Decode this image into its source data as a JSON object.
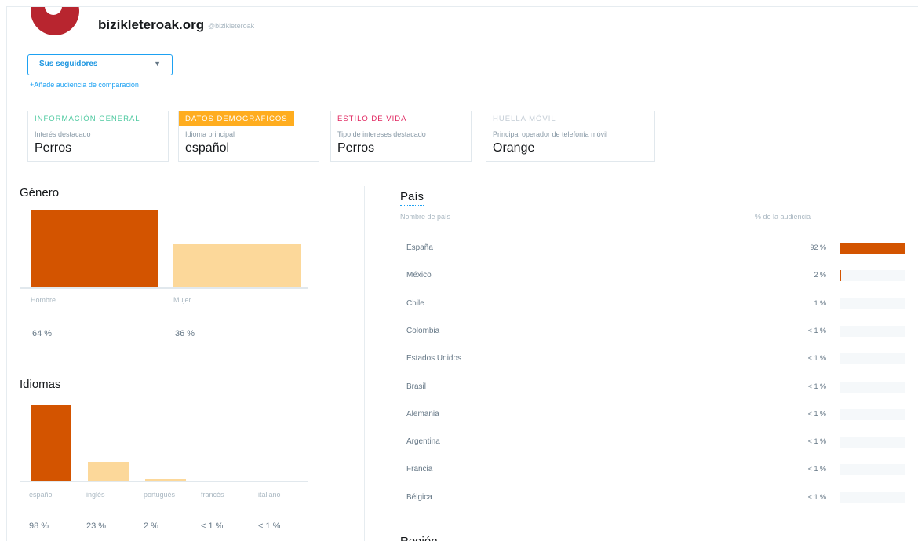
{
  "colors": {
    "accent": "#1da1f2",
    "primary_bar": "#d35400",
    "secondary_bar": "#fcd89a"
  },
  "header": {
    "account_name": "bizikleteroak.org",
    "account_handle": "@bizikleteroak",
    "audience_select": "Sus seguidores",
    "compare_link": "+Añade audiencia de comparación"
  },
  "cards": [
    {
      "tab": "INFORMACIÓN GENERAL",
      "subtitle": "Interés destacado",
      "value": "Perros",
      "tab_color": "#4ec9a0",
      "tab_bg": "transparent"
    },
    {
      "tab": "DATOS DEMOGRÁFICOS",
      "subtitle": "Idioma principal",
      "value": "español",
      "tab_color": "#ffffff",
      "tab_bg": "#ffad1f"
    },
    {
      "tab": "ESTILO DE VIDA",
      "subtitle": "Tipo de intereses destacado",
      "value": "Perros",
      "tab_color": "#e0245e",
      "tab_bg": "transparent"
    },
    {
      "tab": "HUELLA MÓVIL",
      "subtitle": "Principal operador de telefonía móvil",
      "value": "Orange",
      "tab_color": "#c3ccd5",
      "tab_bg": "transparent"
    }
  ],
  "gender": {
    "title": "Género",
    "chart_data": {
      "type": "bar",
      "categories": [
        "Hombre",
        "Mujer"
      ],
      "values": [
        64,
        36
      ],
      "value_labels": [
        "64 %",
        "36 %"
      ],
      "ylim": [
        0,
        64
      ]
    }
  },
  "languages": {
    "title": "Idiomas",
    "chart_data": {
      "type": "bar",
      "categories": [
        "español",
        "inglés",
        "portugués",
        "francés",
        "italiano"
      ],
      "values": [
        98,
        23,
        2,
        0.5,
        0.5
      ],
      "value_labels": [
        "98 %",
        "23 %",
        "2 %",
        "< 1 %",
        "< 1 %"
      ],
      "ylim": [
        0,
        98
      ]
    }
  },
  "country": {
    "title": "País",
    "col_name": "Nombre de país",
    "col_pct": "% de la audiencia",
    "rows": [
      {
        "name": "España",
        "pct": "92 %",
        "value": 92
      },
      {
        "name": "México",
        "pct": "2 %",
        "value": 2
      },
      {
        "name": "Chile",
        "pct": "1 %",
        "value": 1
      },
      {
        "name": "Colombia",
        "pct": "< 1 %",
        "value": 0.5
      },
      {
        "name": "Estados Unidos",
        "pct": "< 1 %",
        "value": 0.5
      },
      {
        "name": "Brasil",
        "pct": "< 1 %",
        "value": 0.5
      },
      {
        "name": "Alemania",
        "pct": "< 1 %",
        "value": 0.5
      },
      {
        "name": "Argentina",
        "pct": "< 1 %",
        "value": 0.5
      },
      {
        "name": "Francia",
        "pct": "< 1 %",
        "value": 0.5
      },
      {
        "name": "Bélgica",
        "pct": "< 1 %",
        "value": 0.5
      }
    ]
  },
  "region": {
    "title": "Región"
  }
}
